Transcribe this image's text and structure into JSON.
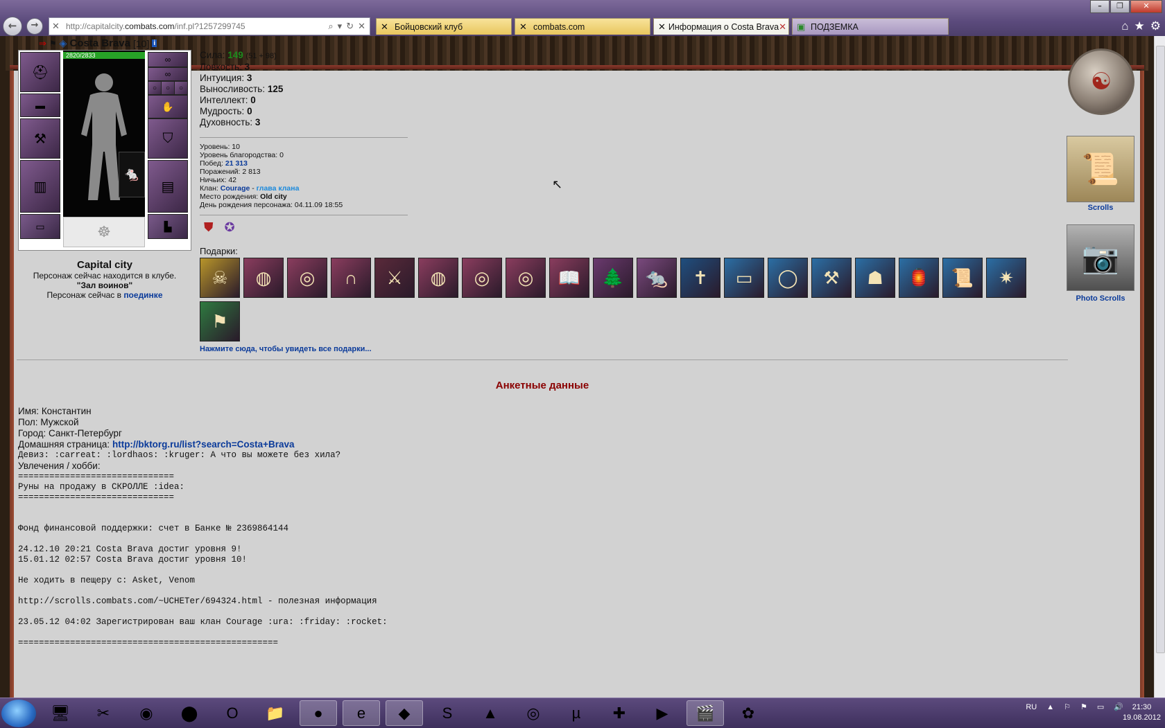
{
  "browser": {
    "url_prefix": "http://capitalcity.",
    "url_host": "combats.com",
    "url_path": "/inf.pl?1257299745",
    "tabs": [
      {
        "label": "Бойцовский клуб",
        "active": false
      },
      {
        "label": "combats.com",
        "active": false
      },
      {
        "label": "Информация о Costa Brava",
        "active": true
      },
      {
        "label": "ПОДЗЕМКА",
        "active": false
      }
    ]
  },
  "character": {
    "name": "Costa Brava",
    "level": "[10]",
    "info_badge": "i",
    "hp": "2820/2833",
    "hp_fraction": 0.995,
    "city": "Capital city",
    "location_line": "Персонаж сейчас находится в клубе.",
    "location_room": "\"Зал воинов\"",
    "fight_prefix": "Персонаж сейчас в",
    "fight_link": "поединке"
  },
  "stats": {
    "strength_label": "Сила:",
    "strength": "149",
    "strength_detail": "(51 + 98)",
    "agility_label": "Ловкость:",
    "agility": "3",
    "intuition_label": "Интуиция:",
    "intuition": "3",
    "endurance_label": "Выносливость:",
    "endurance": "125",
    "intellect_label": "Интеллект:",
    "intellect": "0",
    "wisdom_label": "Мудрость:",
    "wisdom": "0",
    "spirit_label": "Духовность:",
    "spirit": "3"
  },
  "info": {
    "level_label": "Уровень:",
    "level": "10",
    "nobility_label": "Уровень благородства:",
    "nobility": "0",
    "wins_label": "Побед:",
    "wins": "21 313",
    "losses_label": "Поражений:",
    "losses": "2 813",
    "draws_label": "Ничьих:",
    "draws": "42",
    "clan_label": "Клан:",
    "clan": "Courage",
    "clan_sep": " - ",
    "clan_role": "глава клана",
    "birthplace_label": "Место рождения:",
    "birthplace": "Old city",
    "birthday_label": "День рождения персонажа:",
    "birthday": "04.11.09 18:55"
  },
  "gifts": {
    "label": "Подарки:",
    "link": "Нажмите сюда, чтобы увидеть все подарки...",
    "items": [
      {
        "icon": "skull-badge-icon",
        "color": "#b8952a"
      },
      {
        "icon": "drum-icon",
        "color": "#8a3d5e"
      },
      {
        "icon": "target-icon",
        "color": "#8a3d5e"
      },
      {
        "icon": "horseshoe-icon",
        "color": "#8a3d5e"
      },
      {
        "icon": "warrior-icon",
        "color": "#5a2a3a"
      },
      {
        "icon": "drum-icon",
        "color": "#8a3d5e"
      },
      {
        "icon": "target-icon",
        "color": "#8a3d5e"
      },
      {
        "icon": "target-icon",
        "color": "#8a3d5e"
      },
      {
        "icon": "book-icon",
        "color": "#8a3d5e"
      },
      {
        "icon": "tree-icon",
        "color": "#6a3a6e"
      },
      {
        "icon": "rat-icon",
        "color": "#7a4a7e"
      },
      {
        "icon": "tome-icon",
        "color": "#1f4f7f"
      },
      {
        "icon": "tube-icon",
        "color": "#2b6fa5"
      },
      {
        "icon": "crystal-ball-icon",
        "color": "#2b6fa5"
      },
      {
        "icon": "shovel-icon",
        "color": "#2b6fa5"
      },
      {
        "icon": "bust-icon",
        "color": "#2b6fa5"
      },
      {
        "icon": "lantern-icon",
        "color": "#2b6fa5"
      },
      {
        "icon": "scroll-icon",
        "color": "#2b6fa5"
      },
      {
        "icon": "mace-icon",
        "color": "#2b6fa5"
      },
      {
        "icon": "banner-icon",
        "color": "#2e7a40"
      }
    ]
  },
  "profile": {
    "title": "Анкетные данные",
    "name_label": "Имя:",
    "name": "Константин",
    "sex_label": "Пол:",
    "sex": "Мужской",
    "city_label": "Город:",
    "city": "Санкт-Петербург",
    "homepage_label": "Домашняя страница:",
    "homepage": "http://bktorg.ru/list?search=Costa+Brava",
    "motto": "Девиз: :carreat: :lordhaos: :kruger: А что вы можете без хила?",
    "hobby_label": "Увлечения / хобби:",
    "hobby_text": "==============================\nРуны на продажу в СКРОЛЛЕ :idea:\n==============================\n\n\nФонд финансовой поддержки: счет в Банке № 2369864144\n\n24.12.10 20:21 Costa Brava достиг уровня 9!\n15.01.12 02:57 Costa Brava достиг уровня 10!\n\nНе ходить в пещеру с: Asket, Venom\n\nhttp://scrolls.combats.com/~UCHETer/694324.html - полезная информация\n\n23.05.12 04:02 Зарегистрирован ваш клан Courage :ura: :friday: :rocket:\n\n=================================================="
  },
  "widgets": {
    "scrolls_label": "Scrolls",
    "photo_label": "Photo Scrolls"
  },
  "taskbar": {
    "lang": "RU",
    "time": "21:30",
    "date": "19.08.2012"
  },
  "colors": {
    "accent_red": "#8a0000",
    "link_blue": "#0a3a9a",
    "stat_green": "#1c8a1c",
    "page_bg": "#d2d2d2"
  }
}
